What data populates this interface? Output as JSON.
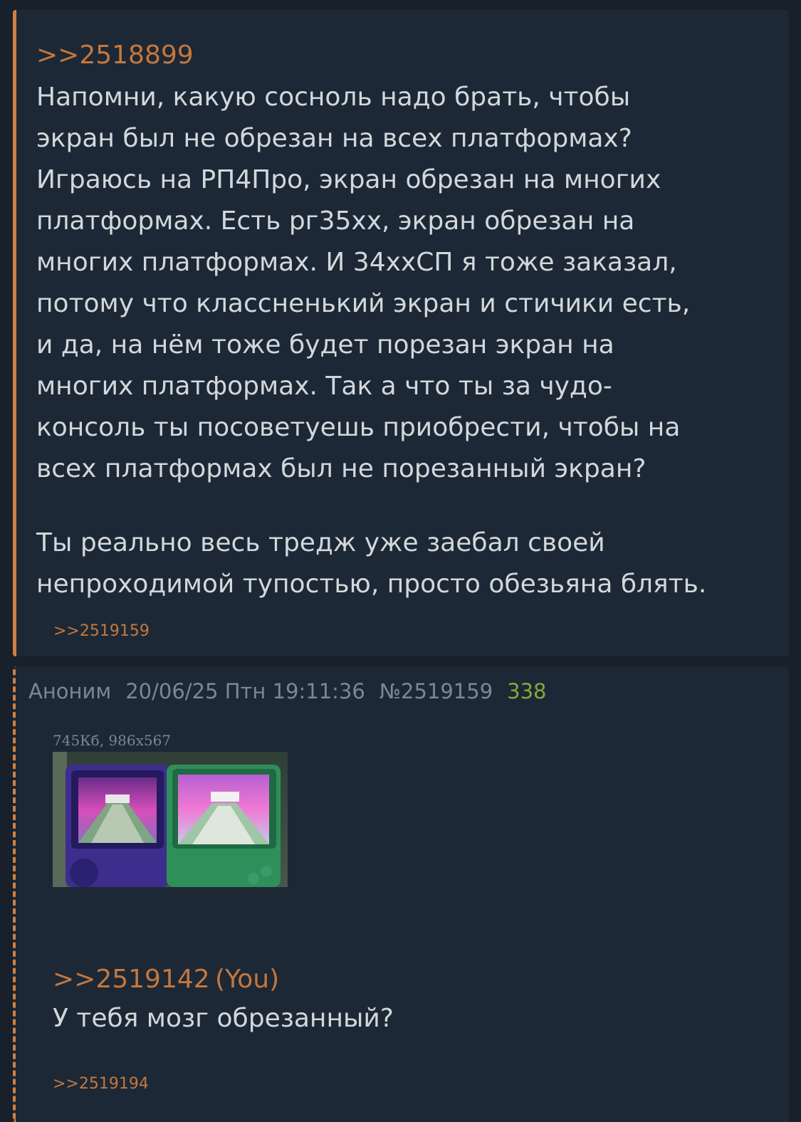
{
  "post1": {
    "quote_link": ">>2518899",
    "quoted_text": "Напомни, какую сосноль надо брать, чтобы\nэкран был не обрезан на всех платформах?\nИграюсь на РП4Про, экран обрезан на многих\nплатформах. Есть рг35хх, экран обрезан на\nмногих платформах. И 34ххСП я тоже заказал,\nпотому что классненький экран и стичики есть,\nи да, на нём тоже будет порезан экран на\nмногих платформах. Так а что ты за чудо-\nконсоль ты посоветуешь приобрести, чтобы на\nвсех платформах был не порезанный экран?",
    "reply_text": "Ты реально весь тредж уже заебал своей\nнепроходимой тупостью, просто обезьяна блять.",
    "backlink": ">>2519159"
  },
  "post2": {
    "author": "Аноним",
    "date": "20/06/25 Птн 19:11:36",
    "post_number": "№2519159",
    "post_count": "338",
    "file_info": "745Кб, 986x567",
    "quote_link": ">>2519142",
    "you_marker": "(You)",
    "text": "У тебя мозг обрезанный?",
    "backlink": ">>2519194"
  },
  "colors": {
    "background": "#17202b",
    "post_background": "#1c2835",
    "link": "#c5773d",
    "text": "#d3d7db",
    "meta": "#7b8893",
    "count": "#85a83a"
  }
}
